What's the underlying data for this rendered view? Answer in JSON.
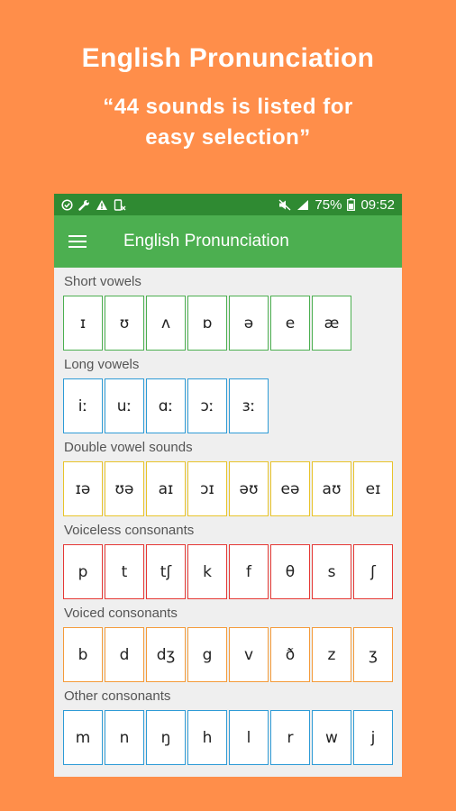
{
  "promo": {
    "title": "English Pronunciation",
    "subtitle_line1": "“44 sounds is listed for",
    "subtitle_line2": "easy selection”"
  },
  "status_bar": {
    "battery": "75%",
    "time": "09:52",
    "left_icons": [
      "check-circle-icon",
      "wrench-icon",
      "warning-icon",
      "device-icon"
    ],
    "right_icons": [
      "mute-icon",
      "signal-icon",
      "battery-icon"
    ]
  },
  "toolbar": {
    "title": "English Pronunciation",
    "menu_icon": "hamburger-menu-icon"
  },
  "colors": {
    "background": "#FF8E4A",
    "toolbar": "#4CAF50",
    "statusbar": "#2F8A32",
    "short_vowels": "#4CAF50",
    "long_vowels": "#2E9BD6",
    "double_vowels": "#E8C32A",
    "voiceless": "#E53935",
    "voiced": "#F49B3A",
    "other": "#2E9BD6"
  },
  "sections": [
    {
      "label": "Short vowels",
      "sounds": [
        "ɪ",
        "ʊ",
        "ʌ",
        "ɒ",
        "ə",
        "e",
        "æ"
      ]
    },
    {
      "label": "Long vowels",
      "sounds": [
        "iː",
        "uː",
        "ɑː",
        "ɔː",
        "ɜː"
      ]
    },
    {
      "label": "Double vowel sounds",
      "sounds": [
        "ɪə",
        "ʊə",
        "aɪ",
        "ɔɪ",
        "əʊ",
        "eə",
        "aʊ",
        "eɪ"
      ]
    },
    {
      "label": "Voiceless consonants",
      "sounds": [
        "p",
        "t",
        "tʃ",
        "k",
        "f",
        "θ",
        "s",
        "ʃ"
      ]
    },
    {
      "label": "Voiced consonants",
      "sounds": [
        "b",
        "d",
        "dʒ",
        "g",
        "v",
        "ð",
        "z",
        "ʒ"
      ]
    },
    {
      "label": "Other consonants",
      "sounds": [
        "m",
        "n",
        "ŋ",
        "h",
        "l",
        "r",
        "w",
        "j"
      ]
    }
  ]
}
